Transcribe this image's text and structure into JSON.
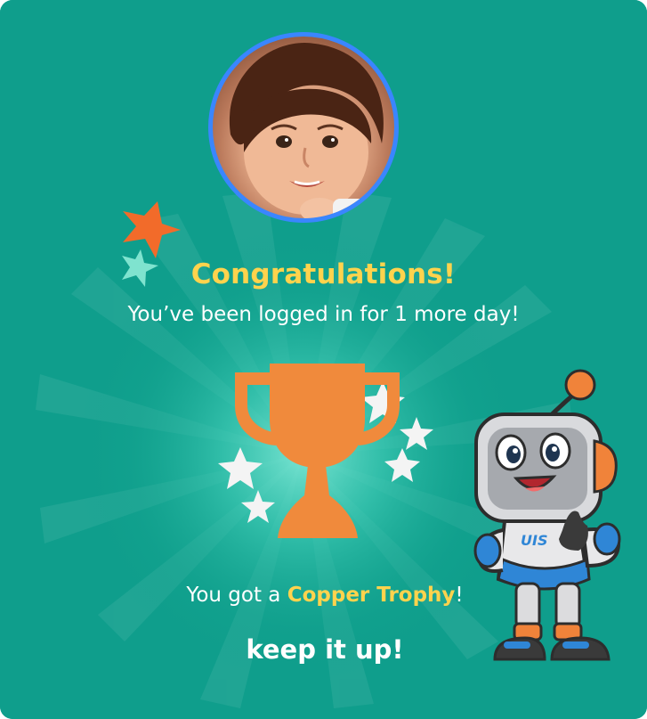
{
  "dialog": {
    "title": "Congratulations!",
    "message": "You’ve been logged in for 1 more day!",
    "award_prefix": "You got a ",
    "award_name": "Copper Trophy",
    "award_suffix": "!",
    "encouragement": "keep it up!"
  },
  "icons": {
    "trophy": "trophy-icon",
    "avatar": "user-avatar",
    "mascot": "robot-mascot"
  },
  "colors": {
    "background": "#0f9e8c",
    "title": "#ffd34d",
    "trophy": "#f08a3c",
    "avatar_ring": "#3a86ff",
    "star_orange": "#f26b2a",
    "star_mint": "#7fe3cf",
    "star_white": "#f4f4f4"
  }
}
